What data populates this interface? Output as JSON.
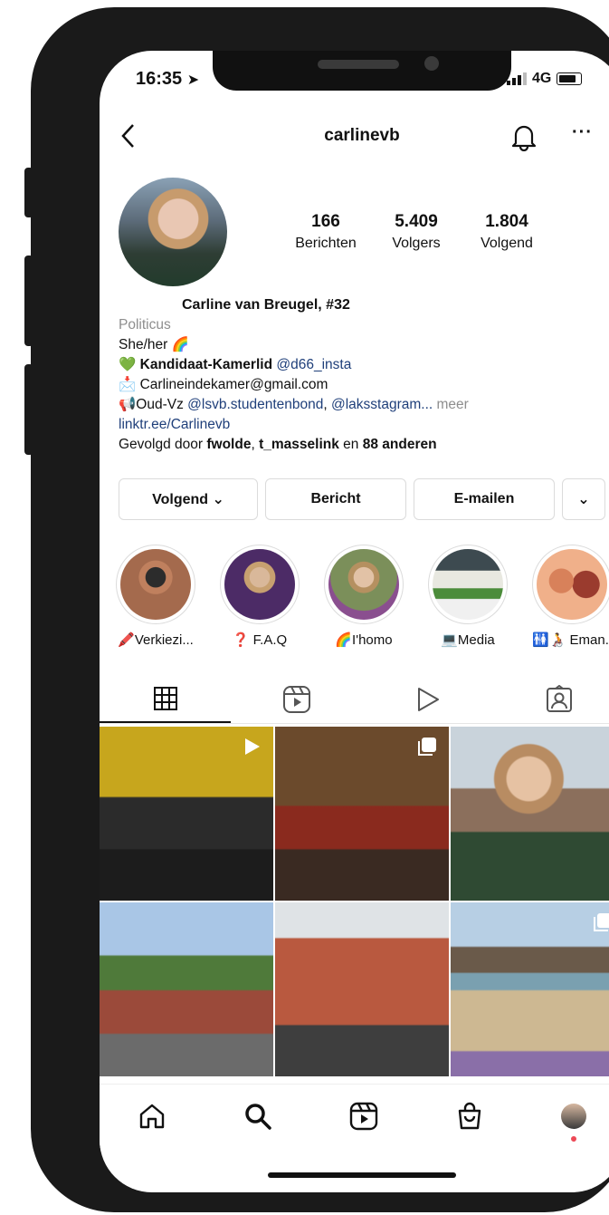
{
  "status": {
    "time": "16:35",
    "network": "4G"
  },
  "header": {
    "username": "carlinevb"
  },
  "stats": [
    {
      "num": "166",
      "label": "Berichten"
    },
    {
      "num": "5.409",
      "label": "Volgers"
    },
    {
      "num": "1.804",
      "label": "Volgend"
    }
  ],
  "bio": {
    "name": "Carline van Breugel, #32",
    "category": "Politicus",
    "pronouns": "She/her 🌈",
    "line1_prefix": "💚",
    "line1_bold": "Kandidaat-Kamerlid",
    "line1_link": "@d66_insta",
    "line2": "📩 Carlineindekamer@gmail.com",
    "line3_prefix": "📢Oud-Vz",
    "line3_link1": "@lsvb.studentenbond",
    "line3_sep": ",",
    "line3_link2": "@laksstagram...",
    "line3_more": "meer",
    "website": "linktr.ee/Carlinevb",
    "followed_prefix": "Gevolgd door",
    "followed_1": "fwolde",
    "followed_sep": ",",
    "followed_2": "t_masselink",
    "followed_mid": "en",
    "followed_3": "88 anderen"
  },
  "buttons": {
    "follow": "Volgend ⌄",
    "message": "Bericht",
    "email": "E-mailen",
    "more": "⌄"
  },
  "highlights": [
    {
      "label": "🖍️Verkiezi...",
      "color": "#b07b59"
    },
    {
      "label": "❓ F.A.Q",
      "color": "#6a3c7e"
    },
    {
      "label": "🌈I'homo",
      "color": "#8a9a6a"
    },
    {
      "label": "💻Media",
      "color": "#6a7f88"
    },
    {
      "label": "🚻🧑‍🦽 Eman...",
      "color": "#d2784a"
    }
  ],
  "colors": {
    "link": "#1f3f7a",
    "secondary": "#8e8e8e",
    "notification_dot": "#ed4956"
  },
  "grid_badges": [
    "reel-icon",
    "",
    "",
    "",
    "",
    "carousel-icon"
  ]
}
